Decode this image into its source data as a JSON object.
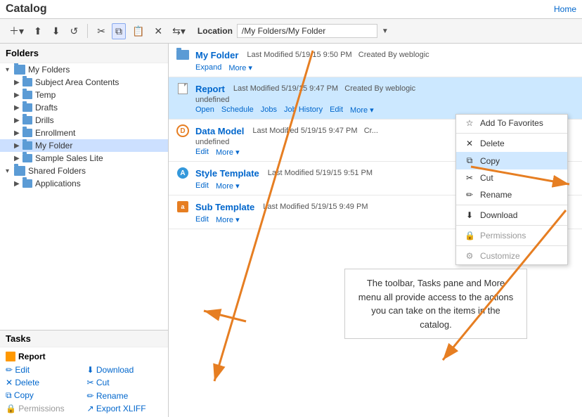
{
  "header": {
    "title": "Catalog",
    "home_label": "Home"
  },
  "toolbar": {
    "location_label": "Location",
    "location_path": "/My Folders/My Folder",
    "buttons": [
      "new",
      "upload",
      "download",
      "refresh",
      "cut",
      "copy",
      "paste",
      "delete",
      "move"
    ]
  },
  "sidebar": {
    "folders_title": "Folders",
    "tree": [
      {
        "id": "my-folders",
        "label": "My Folders",
        "indent": 1,
        "expanded": true,
        "arrow": "▾"
      },
      {
        "id": "subject-area",
        "label": "Subject Area Contents",
        "indent": 2,
        "arrow": "▶"
      },
      {
        "id": "temp",
        "label": "Temp",
        "indent": 2,
        "arrow": "▶"
      },
      {
        "id": "drafts",
        "label": "Drafts",
        "indent": 2,
        "arrow": "▶"
      },
      {
        "id": "drills",
        "label": "Drills",
        "indent": 2,
        "arrow": "▶"
      },
      {
        "id": "enrollment",
        "label": "Enrollment",
        "indent": 2,
        "arrow": "▶"
      },
      {
        "id": "my-folder",
        "label": "My Folder",
        "indent": 2,
        "arrow": "▶",
        "selected": true
      },
      {
        "id": "sample-sales",
        "label": "Sample Sales Lite",
        "indent": 2,
        "arrow": "▶"
      },
      {
        "id": "shared-folders",
        "label": "Shared Folders",
        "indent": 1,
        "expanded": true,
        "arrow": "▾"
      },
      {
        "id": "applications",
        "label": "Applications",
        "indent": 2,
        "arrow": "▶"
      }
    ],
    "tasks_title": "Tasks",
    "report_name": "Report",
    "actions": [
      {
        "id": "edit",
        "label": "Edit",
        "icon": "✏️",
        "disabled": false
      },
      {
        "id": "download-task",
        "label": "Download",
        "icon": "⬇",
        "disabled": false
      },
      {
        "id": "delete",
        "label": "Delete",
        "icon": "✕",
        "disabled": false
      },
      {
        "id": "cut",
        "label": "Cut",
        "icon": "✂",
        "disabled": false
      },
      {
        "id": "copy",
        "label": "Copy",
        "icon": "⧉",
        "disabled": false
      },
      {
        "id": "rename",
        "label": "Rename",
        "icon": "✏",
        "disabled": false
      },
      {
        "id": "permissions",
        "label": "Permissions",
        "icon": "🔒",
        "disabled": true
      },
      {
        "id": "export-xliff",
        "label": "Export XLIFF",
        "icon": "↗",
        "disabled": false
      }
    ]
  },
  "content": {
    "items": [
      {
        "id": "my-folder-item",
        "type": "folder",
        "name": "My Folder",
        "meta": "Last Modified 5/19/15 9:50 PM   Created By weblogic",
        "actions": [
          "Expand",
          "More ▾"
        ]
      },
      {
        "id": "report-item",
        "type": "report",
        "name": "Report",
        "meta": "Last Modified 5/19/15 9:47 PM   Created By weblogic",
        "subtext": "undefined",
        "actions": [
          "Open",
          "Schedule",
          "Jobs",
          "Job History",
          "Edit",
          "More ▾"
        ],
        "highlighted": true
      },
      {
        "id": "data-model-item",
        "type": "data-model",
        "name": "Data Model",
        "meta": "Last Modified 5/19/15 9:47 PM   Cr...",
        "subtext": "undefined",
        "actions": [
          "Edit",
          "More ▾"
        ]
      },
      {
        "id": "style-template-item",
        "type": "style-template",
        "name": "Style Template",
        "meta": "Last Modified 5/19/15 9:51 PM",
        "actions": [
          "Edit",
          "More ▾"
        ]
      },
      {
        "id": "sub-template-item",
        "type": "sub-template",
        "name": "Sub Template",
        "meta": "Last Modified 5/19/15 9:49 PM",
        "actions": [
          "Edit",
          "More ▾"
        ]
      }
    ]
  },
  "context_menu": {
    "items": [
      {
        "id": "add-to-favorites",
        "label": "Add To Favorites",
        "icon": "☆",
        "disabled": false
      },
      {
        "id": "separator1",
        "separator": true
      },
      {
        "id": "delete",
        "label": "Delete",
        "icon": "✕",
        "disabled": false
      },
      {
        "id": "copy",
        "label": "Copy",
        "icon": "⧉",
        "disabled": false,
        "active": true
      },
      {
        "id": "cut",
        "label": "Cut",
        "icon": "✂",
        "disabled": false
      },
      {
        "id": "rename",
        "label": "Rename",
        "icon": "✏",
        "disabled": false
      },
      {
        "id": "separator2",
        "separator": true
      },
      {
        "id": "download",
        "label": "Download",
        "icon": "⬇",
        "disabled": false
      },
      {
        "id": "separator3",
        "separator": true
      },
      {
        "id": "permissions",
        "label": "Permissions",
        "icon": "🔒",
        "disabled": true
      },
      {
        "id": "separator4",
        "separator": true
      },
      {
        "id": "customize",
        "label": "Customize",
        "icon": "⚙",
        "disabled": true
      }
    ]
  },
  "info_box": {
    "text": "The toolbar, Tasks pane and More menu all provide access to the actions you can take on the items in the catalog."
  }
}
